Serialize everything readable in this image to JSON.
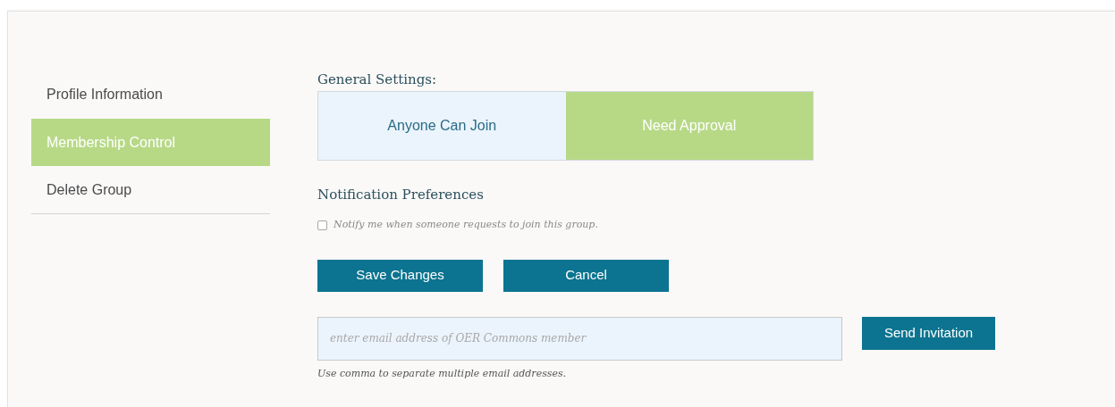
{
  "sidebar": {
    "items": [
      {
        "label": "Profile Information",
        "selected": false
      },
      {
        "label": "Membership Control",
        "selected": true
      },
      {
        "label": "Delete Group",
        "selected": false
      }
    ]
  },
  "general_settings": {
    "heading": "General Settings:",
    "options": [
      {
        "label": "Anyone Can Join",
        "selected": false
      },
      {
        "label": "Need Approval",
        "selected": true
      }
    ]
  },
  "notification_preferences": {
    "heading": "Notification Preferences",
    "checkbox": {
      "label": "Notify me when someone requests to join this group.",
      "checked": false
    }
  },
  "buttons": [
    "Save Changes",
    "Cancel"
  ],
  "invite": {
    "placeholder": "enter email address of OER Commons member",
    "button": "Send Invitation",
    "hint": "Use comma to separate multiple email addresses."
  }
}
